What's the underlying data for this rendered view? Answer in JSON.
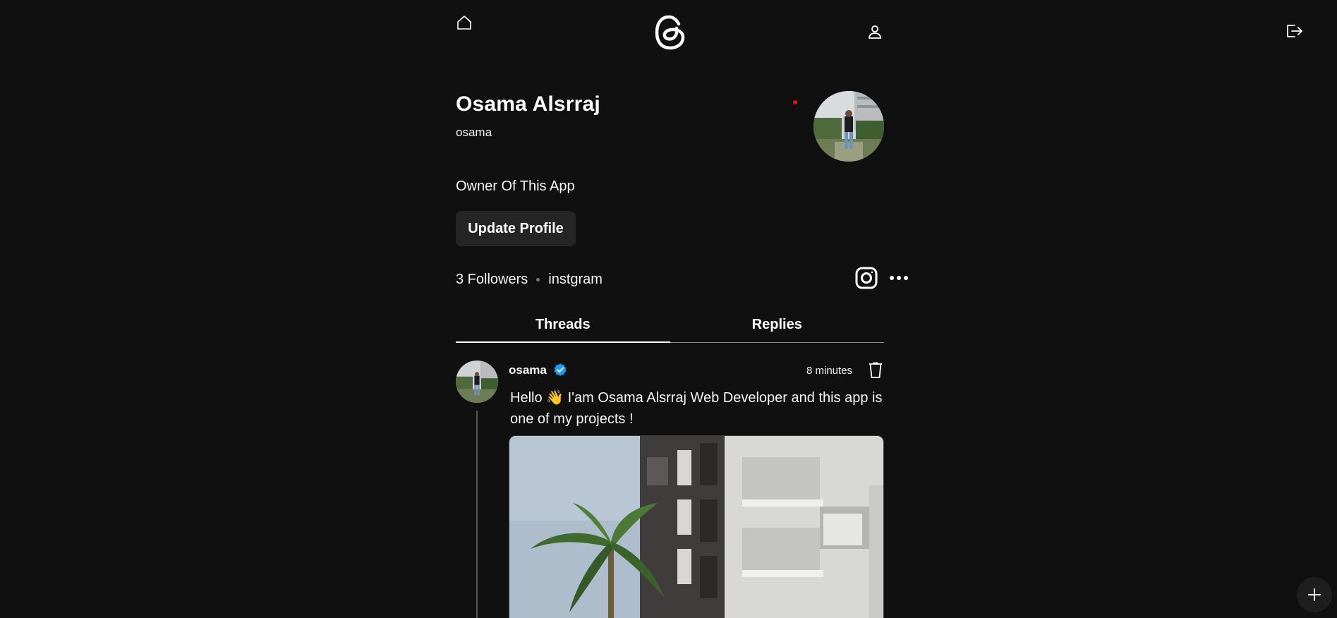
{
  "nav": {
    "home_icon": "home-icon",
    "logo_icon": "threads-logo-icon",
    "profile_icon": "user-icon",
    "logout_icon": "logout-icon"
  },
  "profile": {
    "name": "Osama Alsrraj",
    "username": "osama",
    "bio": "Owner Of This App",
    "update_button": "Update Profile",
    "followers": "3 Followers",
    "link": "instgram",
    "instagram_icon": "instagram-icon",
    "more_icon": "more-horizontal-icon"
  },
  "tabs": [
    {
      "label": "Threads",
      "active": true
    },
    {
      "label": "Replies",
      "active": false
    }
  ],
  "post": {
    "author": "osama",
    "time": "8 minutes",
    "text": "Hello 👋 I'am Osama Alsrraj Web Developer and this app is one of my projects !"
  },
  "fab_icon": "plus-icon",
  "colors": {
    "background": "#101010",
    "text": "#f3f5f7",
    "button_bg": "#252525",
    "verified": "#1d9bf0",
    "status_dot": "#e0141e"
  }
}
